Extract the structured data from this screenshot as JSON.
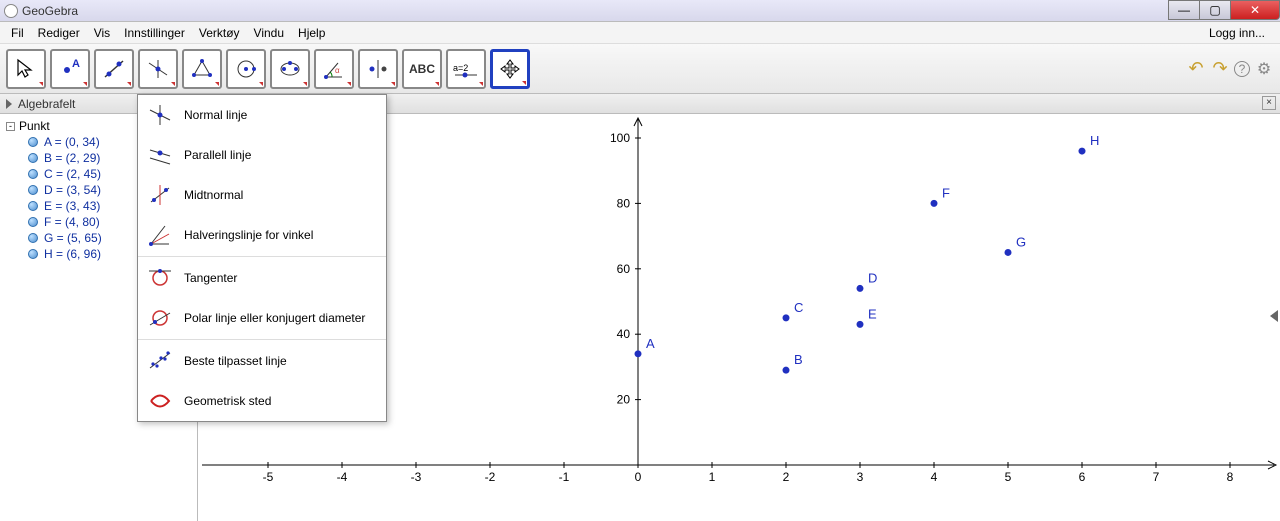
{
  "window": {
    "title": "GeoGebra",
    "min": "—",
    "max": "▢",
    "close": "✕"
  },
  "menu": {
    "file": "Fil",
    "edit": "Rediger",
    "view": "Vis",
    "settings": "Innstillinger",
    "tools": "Verktøy",
    "window": "Vindu",
    "help": "Hjelp",
    "login": "Logg inn..."
  },
  "toolbar_right": {
    "undo": "↶",
    "redo": "↷",
    "help": "?",
    "prefs": "⚙"
  },
  "panel": {
    "algebra": "Algebrafelt",
    "close": "×"
  },
  "algebra": {
    "folder": "Punkt",
    "points": [
      {
        "label": "A = (0, 34)"
      },
      {
        "label": "B = (2, 29)"
      },
      {
        "label": "C = (2, 45)"
      },
      {
        "label": "D = (3, 54)"
      },
      {
        "label": "E = (3, 43)"
      },
      {
        "label": "F = (4, 80)"
      },
      {
        "label": "G = (5, 65)"
      },
      {
        "label": "H = (6, 96)"
      }
    ]
  },
  "dropdown": {
    "items": [
      {
        "label": "Normal linje",
        "icon": "perp"
      },
      {
        "label": "Parallell linje",
        "icon": "parallel"
      },
      {
        "label": "Midtnormal",
        "icon": "midperp"
      },
      {
        "label": "Halveringslinje for vinkel",
        "icon": "bisector"
      }
    ],
    "items2": [
      {
        "label": "Tangenter",
        "icon": "tangent"
      },
      {
        "label": "Polar linje eller konjugert diameter",
        "icon": "polar"
      }
    ],
    "items3": [
      {
        "label": "Beste tilpasset linje",
        "icon": "bestfit"
      },
      {
        "label": "Geometrisk sted",
        "icon": "locus"
      }
    ]
  },
  "tool_icons": {
    "t0": "move",
    "t1": "point",
    "t2": "line",
    "t3": "special_line",
    "t4": "polygon",
    "t5": "circle",
    "t6": "ellipse",
    "t7": "angle",
    "t8": "reflect",
    "t9": "text",
    "t10": "slider",
    "t11": "move_view"
  },
  "chart_data": {
    "type": "scatter",
    "title": "",
    "xlabel": "",
    "ylabel": "",
    "x_ticks": [
      -5,
      -4,
      -3,
      -2,
      -1,
      0,
      1,
      2,
      3,
      4,
      5,
      6,
      7,
      8
    ],
    "y_ticks": [
      20,
      40,
      60,
      80,
      100
    ],
    "xlim": [
      -6,
      8.5
    ],
    "ylim": [
      0,
      108
    ],
    "series": [
      {
        "name": "Punkt",
        "points": [
          {
            "name": "A",
            "x": 0,
            "y": 34
          },
          {
            "name": "B",
            "x": 2,
            "y": 29
          },
          {
            "name": "C",
            "x": 2,
            "y": 45
          },
          {
            "name": "D",
            "x": 3,
            "y": 54
          },
          {
            "name": "E",
            "x": 3,
            "y": 43
          },
          {
            "name": "F",
            "x": 4,
            "y": 80
          },
          {
            "name": "G",
            "x": 5,
            "y": 65
          },
          {
            "name": "H",
            "x": 6,
            "y": 96
          }
        ]
      }
    ]
  }
}
